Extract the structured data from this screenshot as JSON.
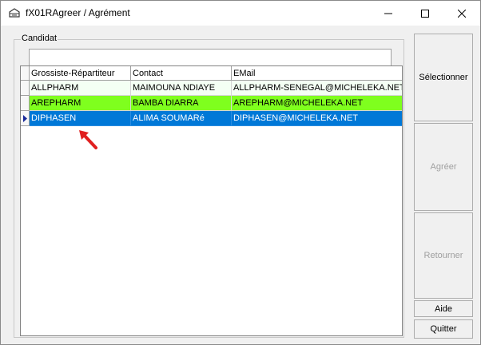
{
  "window": {
    "title": "fX01RAgreer / Agrément"
  },
  "group": {
    "label": "Candidat"
  },
  "filter": {
    "value": ""
  },
  "grid": {
    "columns": [
      "Grossiste-Répartiteur",
      "Contact",
      "EMail"
    ],
    "rows": [
      {
        "cells": [
          "ALLPHARM",
          "MAIMOUNA NDIAYE",
          "ALLPHARM-SENEGAL@MICHELEKA.NET"
        ],
        "state": "normal"
      },
      {
        "cells": [
          "AREPHARM",
          "BAMBA DIARRA",
          "AREPHARM@MICHELEKA.NET"
        ],
        "state": "highlighted"
      },
      {
        "cells": [
          "DIPHASEN",
          "ALIMA SOUMARé",
          "DIPHASEN@MICHELEKA.NET"
        ],
        "state": "selected"
      }
    ]
  },
  "buttons": {
    "select": "Sélectionner",
    "approve": "Agréer",
    "return": "Retourner",
    "help": "Aide",
    "quit": "Quitter"
  },
  "colors": {
    "highlight_row": "#7fff1e",
    "selected_row": "#0078d7",
    "normal_row": "#f4fff4",
    "arrow": "#e02020"
  },
  "icons": [
    "app-icon",
    "minimize-icon",
    "maximize-icon",
    "close-icon",
    "current-row-indicator-icon",
    "annotation-arrow-icon"
  ]
}
